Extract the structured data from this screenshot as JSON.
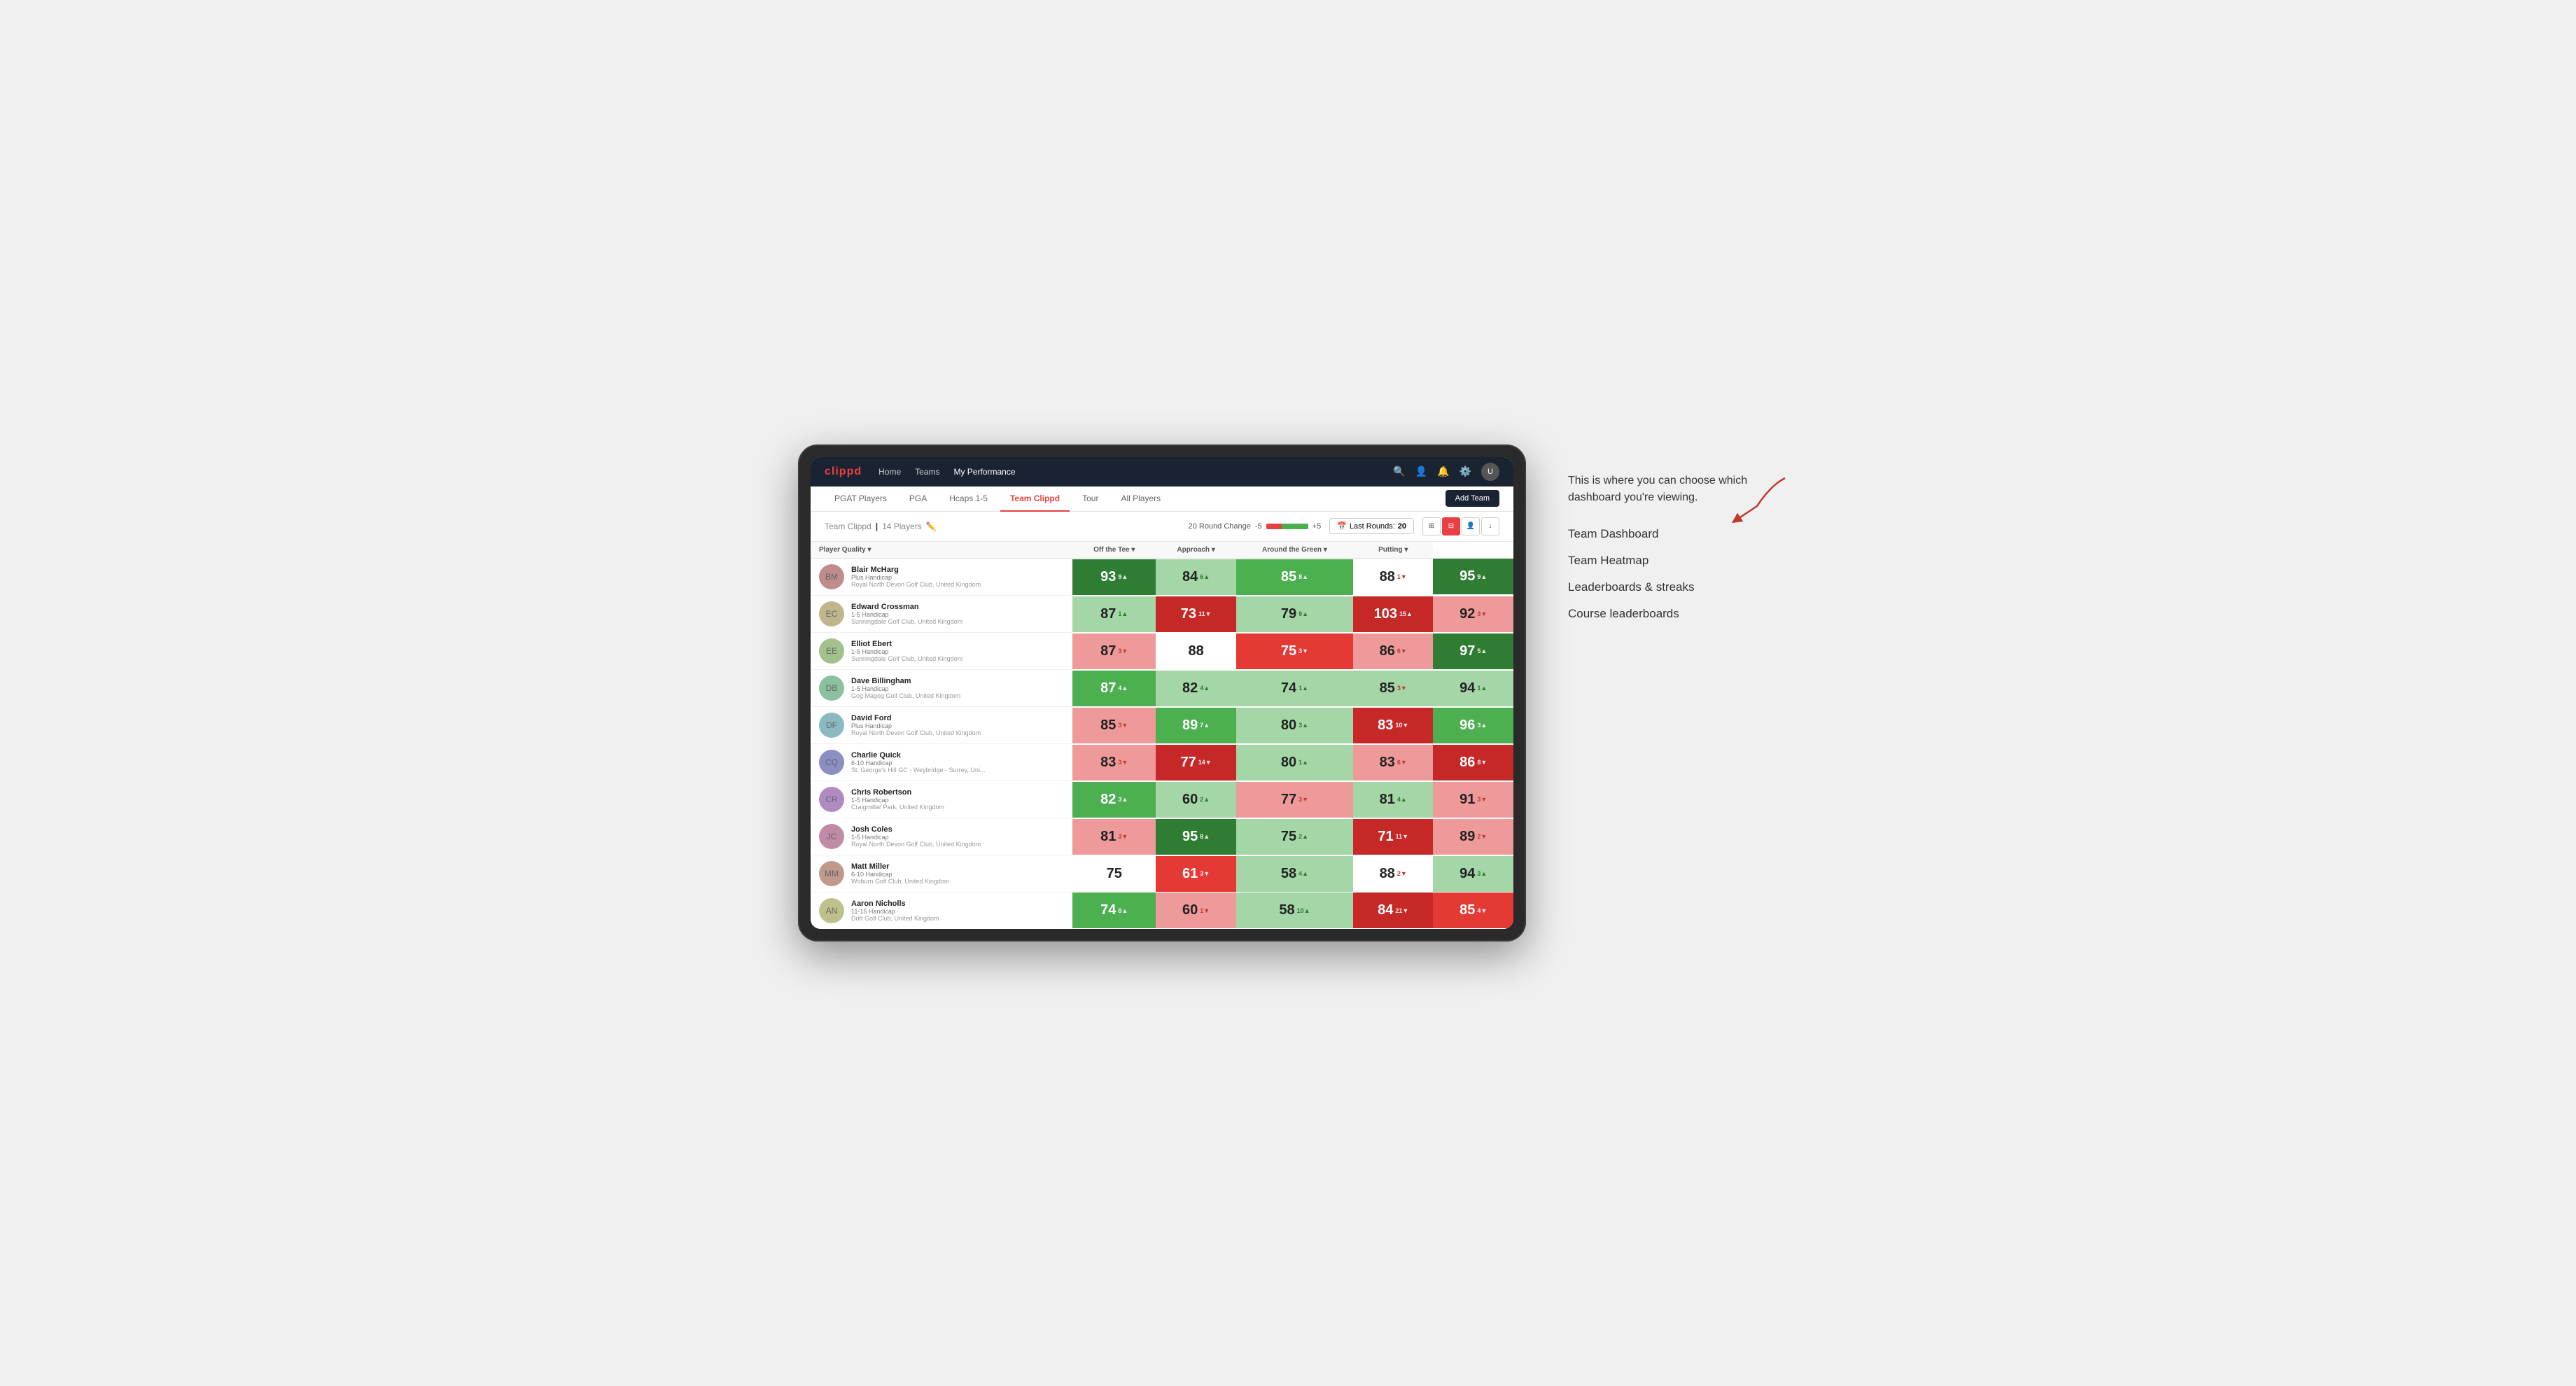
{
  "annotation": {
    "intro": "This is where you can choose which dashboard you're viewing.",
    "items": [
      "Team Dashboard",
      "Team Heatmap",
      "Leaderboards & streaks",
      "Course leaderboards"
    ]
  },
  "nav": {
    "logo": "clippd",
    "links": [
      "Home",
      "Teams",
      "My Performance"
    ],
    "active_link": "My Performance"
  },
  "tabs": {
    "items": [
      "PGAT Players",
      "PGA",
      "Hcaps 1-5",
      "Team Clippd",
      "Tour",
      "All Players"
    ],
    "active": "Team Clippd",
    "add_button": "Add Team"
  },
  "sub_header": {
    "team_name": "Team Clippd",
    "player_count": "14 Players",
    "round_change_label": "20 Round Change",
    "round_change_neg": "-5",
    "round_change_pos": "+5",
    "last_rounds_label": "Last Rounds:",
    "last_rounds_value": "20"
  },
  "columns": {
    "player": "Player Quality ▾",
    "off_tee": "Off the Tee ▾",
    "approach": "Approach ▾",
    "around_green": "Around the Green ▾",
    "putting": "Putting ▾"
  },
  "players": [
    {
      "name": "Blair McHarg",
      "handicap": "Plus Handicap",
      "club": "Royal North Devon Golf Club, United Kingdom",
      "scores": [
        {
          "value": "93",
          "change": "9",
          "dir": "up",
          "color": "green-dark"
        },
        {
          "value": "84",
          "change": "6",
          "dir": "up",
          "color": "green-light"
        },
        {
          "value": "85",
          "change": "8",
          "dir": "up",
          "color": "green-medium"
        },
        {
          "value": "88",
          "change": "1",
          "dir": "down",
          "color": "white"
        },
        {
          "value": "95",
          "change": "9",
          "dir": "up",
          "color": "green-dark"
        }
      ]
    },
    {
      "name": "Edward Crossman",
      "handicap": "1-5 Handicap",
      "club": "Sunningdale Golf Club, United Kingdom",
      "scores": [
        {
          "value": "87",
          "change": "1",
          "dir": "up",
          "color": "green-light"
        },
        {
          "value": "73",
          "change": "11",
          "dir": "down",
          "color": "red-dark"
        },
        {
          "value": "79",
          "change": "9",
          "dir": "up",
          "color": "green-light"
        },
        {
          "value": "103",
          "change": "15",
          "dir": "up",
          "color": "red-dark"
        },
        {
          "value": "92",
          "change": "3",
          "dir": "down",
          "color": "red-light"
        }
      ]
    },
    {
      "name": "Elliot Ebert",
      "handicap": "1-5 Handicap",
      "club": "Sunningdale Golf Club, United Kingdom",
      "scores": [
        {
          "value": "87",
          "change": "3",
          "dir": "down",
          "color": "red-light"
        },
        {
          "value": "88",
          "change": "",
          "dir": "",
          "color": "white"
        },
        {
          "value": "75",
          "change": "3",
          "dir": "down",
          "color": "red-medium"
        },
        {
          "value": "86",
          "change": "6",
          "dir": "down",
          "color": "red-light"
        },
        {
          "value": "97",
          "change": "5",
          "dir": "up",
          "color": "green-dark"
        }
      ]
    },
    {
      "name": "Dave Billingham",
      "handicap": "1-5 Handicap",
      "club": "Gog Magog Golf Club, United Kingdom",
      "scores": [
        {
          "value": "87",
          "change": "4",
          "dir": "up",
          "color": "green-medium"
        },
        {
          "value": "82",
          "change": "4",
          "dir": "up",
          "color": "green-light"
        },
        {
          "value": "74",
          "change": "1",
          "dir": "up",
          "color": "green-light"
        },
        {
          "value": "85",
          "change": "3",
          "dir": "down",
          "color": "green-light"
        },
        {
          "value": "94",
          "change": "1",
          "dir": "up",
          "color": "green-light"
        }
      ]
    },
    {
      "name": "David Ford",
      "handicap": "Plus Handicap",
      "club": "Royal North Devon Golf Club, United Kingdom",
      "scores": [
        {
          "value": "85",
          "change": "3",
          "dir": "down",
          "color": "red-light"
        },
        {
          "value": "89",
          "change": "7",
          "dir": "up",
          "color": "green-medium"
        },
        {
          "value": "80",
          "change": "3",
          "dir": "up",
          "color": "green-light"
        },
        {
          "value": "83",
          "change": "10",
          "dir": "down",
          "color": "red-dark"
        },
        {
          "value": "96",
          "change": "3",
          "dir": "up",
          "color": "green-medium"
        }
      ]
    },
    {
      "name": "Charlie Quick",
      "handicap": "6-10 Handicap",
      "club": "St. George's Hill GC - Weybridge - Surrey, Uni...",
      "scores": [
        {
          "value": "83",
          "change": "3",
          "dir": "down",
          "color": "red-light"
        },
        {
          "value": "77",
          "change": "14",
          "dir": "down",
          "color": "red-dark"
        },
        {
          "value": "80",
          "change": "1",
          "dir": "up",
          "color": "green-light"
        },
        {
          "value": "83",
          "change": "6",
          "dir": "down",
          "color": "red-light"
        },
        {
          "value": "86",
          "change": "8",
          "dir": "down",
          "color": "red-dark"
        }
      ]
    },
    {
      "name": "Chris Robertson",
      "handicap": "1-5 Handicap",
      "club": "Craigmillar Park, United Kingdom",
      "scores": [
        {
          "value": "82",
          "change": "3",
          "dir": "up",
          "color": "green-medium"
        },
        {
          "value": "60",
          "change": "2",
          "dir": "up",
          "color": "green-light"
        },
        {
          "value": "77",
          "change": "3",
          "dir": "down",
          "color": "red-light"
        },
        {
          "value": "81",
          "change": "4",
          "dir": "up",
          "color": "green-light"
        },
        {
          "value": "91",
          "change": "3",
          "dir": "down",
          "color": "red-light"
        }
      ]
    },
    {
      "name": "Josh Coles",
      "handicap": "1-5 Handicap",
      "club": "Royal North Devon Golf Club, United Kingdom",
      "scores": [
        {
          "value": "81",
          "change": "3",
          "dir": "down",
          "color": "red-light"
        },
        {
          "value": "95",
          "change": "8",
          "dir": "up",
          "color": "green-dark"
        },
        {
          "value": "75",
          "change": "2",
          "dir": "up",
          "color": "green-light"
        },
        {
          "value": "71",
          "change": "11",
          "dir": "down",
          "color": "red-dark"
        },
        {
          "value": "89",
          "change": "2",
          "dir": "down",
          "color": "red-light"
        }
      ]
    },
    {
      "name": "Matt Miller",
      "handicap": "6-10 Handicap",
      "club": "Woburn Golf Club, United Kingdom",
      "scores": [
        {
          "value": "75",
          "change": "",
          "dir": "",
          "color": "white"
        },
        {
          "value": "61",
          "change": "3",
          "dir": "down",
          "color": "red-medium"
        },
        {
          "value": "58",
          "change": "4",
          "dir": "up",
          "color": "green-light"
        },
        {
          "value": "88",
          "change": "2",
          "dir": "down",
          "color": "white"
        },
        {
          "value": "94",
          "change": "3",
          "dir": "up",
          "color": "green-light"
        }
      ]
    },
    {
      "name": "Aaron Nicholls",
      "handicap": "11-15 Handicap",
      "club": "Drift Golf Club, United Kingdom",
      "scores": [
        {
          "value": "74",
          "change": "8",
          "dir": "up",
          "color": "green-medium"
        },
        {
          "value": "60",
          "change": "1",
          "dir": "down",
          "color": "red-light"
        },
        {
          "value": "58",
          "change": "10",
          "dir": "up",
          "color": "green-light"
        },
        {
          "value": "84",
          "change": "21",
          "dir": "down",
          "color": "red-dark"
        },
        {
          "value": "85",
          "change": "4",
          "dir": "down",
          "color": "red-medium"
        }
      ]
    }
  ]
}
